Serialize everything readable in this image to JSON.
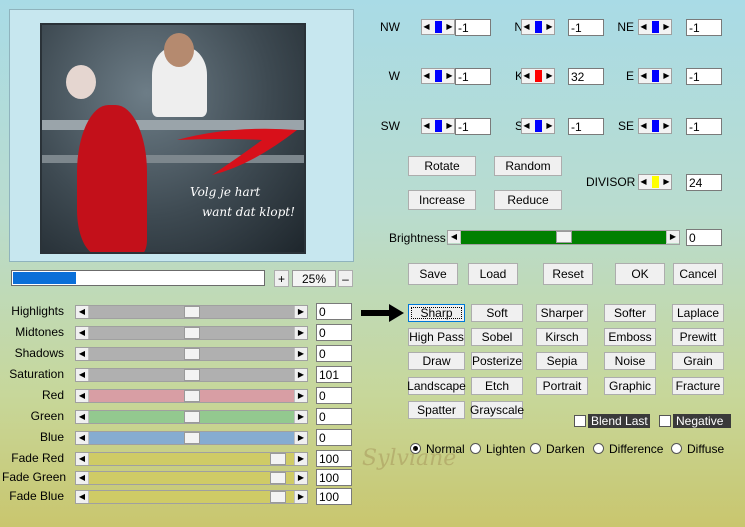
{
  "preview": {
    "caption_line1": "Volg je hart",
    "caption_line2": "want dat klopt!"
  },
  "progress": {
    "percent": 25,
    "plus": "+",
    "minus": "–",
    "zoom_label": "25%"
  },
  "tone": [
    {
      "label": "Highlights",
      "value": "0",
      "level": 0.5,
      "color": "#b0b0b0"
    },
    {
      "label": "Midtones",
      "value": "0",
      "level": 0.5,
      "color": "#b0b0b0"
    },
    {
      "label": "Shadows",
      "value": "0",
      "level": 0.5,
      "color": "#b0b0b0"
    },
    {
      "label": "Saturation",
      "value": "101",
      "level": 0.5,
      "color": "#b0b0b0"
    },
    {
      "label": "Red",
      "value": "0",
      "level": 0.5,
      "color": "#d89ea4"
    },
    {
      "label": "Green",
      "value": "0",
      "level": 0.5,
      "color": "#93c98f"
    },
    {
      "label": "Blue",
      "value": "0",
      "level": 0.5,
      "color": "#86acd1"
    },
    {
      "label": "Fade Red",
      "value": "100",
      "level": 0.96,
      "color": "#cfcb66"
    },
    {
      "label": "Fade Green",
      "value": "100",
      "level": 0.96,
      "color": "#cfcb66"
    },
    {
      "label": "Fade Blue",
      "value": "100",
      "level": 0.96,
      "color": "#cfcb66"
    }
  ],
  "kernel": [
    {
      "label": "NW",
      "value": "-1",
      "marker": "#0000ff"
    },
    {
      "label": "N",
      "value": "-1",
      "marker": "#0000ff"
    },
    {
      "label": "NE",
      "value": "-1",
      "marker": "#0000ff"
    },
    {
      "label": "W",
      "value": "-1",
      "marker": "#0000ff"
    },
    {
      "label": "K",
      "value": "32",
      "marker": "#ff0000"
    },
    {
      "label": "E",
      "value": "-1",
      "marker": "#0000ff"
    },
    {
      "label": "SW",
      "value": "-1",
      "marker": "#0000ff"
    },
    {
      "label": "S",
      "value": "-1",
      "marker": "#0000ff"
    },
    {
      "label": "SE",
      "value": "-1",
      "marker": "#0000ff"
    }
  ],
  "matrix_buttons": {
    "rotate": "Rotate",
    "random": "Random",
    "increase": "Increase",
    "reduce": "Reduce"
  },
  "divisor": {
    "label": "DIVISOR",
    "value": "24",
    "marker": "#ffff00"
  },
  "brightness": {
    "label": "Brightness",
    "value": "0",
    "level": 0.5,
    "color": "#008000"
  },
  "actions": {
    "save": "Save",
    "load": "Load",
    "reset": "Reset",
    "ok": "OK",
    "cancel": "Cancel"
  },
  "presets": [
    [
      "Sharp",
      "Soft",
      "Sharper",
      "Softer",
      "Laplace"
    ],
    [
      "High Pass",
      "Sobel",
      "Kirsch",
      "Emboss",
      "Prewitt"
    ],
    [
      "Draw",
      "Posterize",
      "Sepia",
      "Noise",
      "Grain"
    ],
    [
      "Landscape",
      "Etch",
      "Portrait",
      "Graphic",
      "Fracture"
    ],
    [
      "Spatter",
      "Grayscale"
    ]
  ],
  "options": {
    "blend_last": "Blend Last",
    "negative": "Negative"
  },
  "blend_modes": [
    {
      "label": "Normal",
      "selected": true
    },
    {
      "label": "Lighten",
      "selected": false
    },
    {
      "label": "Darken",
      "selected": false
    },
    {
      "label": "Difference",
      "selected": false
    },
    {
      "label": "Diffuse",
      "selected": false
    }
  ],
  "watermark": "Sylviane"
}
